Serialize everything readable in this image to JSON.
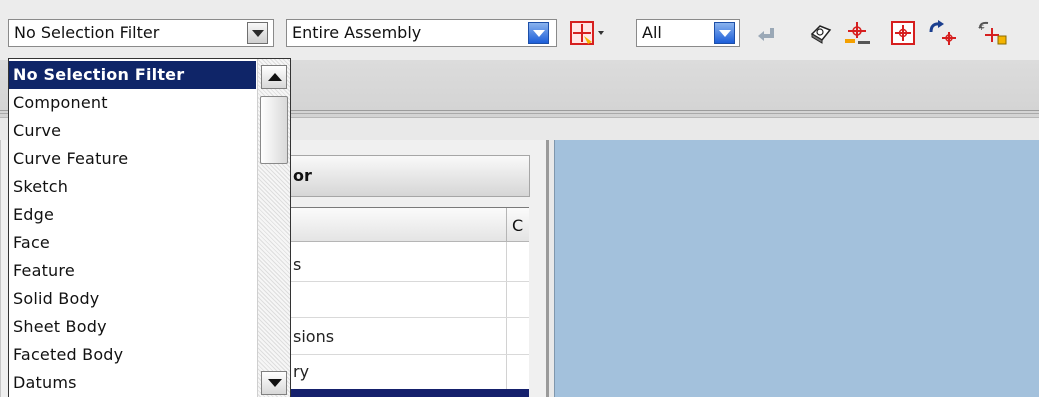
{
  "toolbar": {
    "selection_filter": {
      "value": "No Selection Filter"
    },
    "scope": {
      "value": "Entire Assembly"
    },
    "type_filter": {
      "value": "All"
    },
    "icons": [
      "snap-point-icon",
      "undo-arrow-icon",
      "view-cube-icon",
      "snap-midpoint-icon",
      "snap-box-icon",
      "rotate-snap-icon",
      "snap-tools-icon"
    ]
  },
  "dropdown": {
    "items": [
      "No Selection Filter",
      "Component",
      "Curve",
      "Curve Feature",
      "Sketch",
      "Edge",
      "Face",
      "Feature",
      "Solid Body",
      "Sheet Body",
      "Faceted Body",
      "Datums"
    ],
    "selected_index": 0
  },
  "navigator": {
    "header_fragment": "or",
    "column_fragment": "C",
    "rows": [
      "s",
      "",
      "sions",
      "ry"
    ]
  },
  "colors": {
    "selection": "#0f2568",
    "viewport": "#a3c1dc",
    "combo_arrow": "#1d5ed8"
  }
}
